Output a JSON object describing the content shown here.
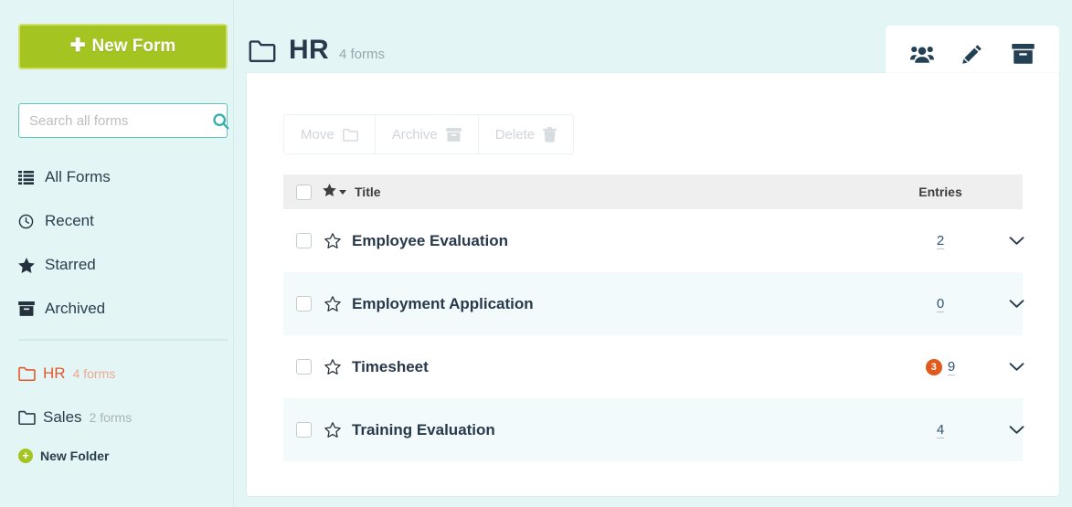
{
  "sidebar": {
    "new_form_button": "New Form",
    "plus_glyph": "✚",
    "search": {
      "placeholder": "Search all forms",
      "value": "",
      "icon": "search-icon"
    },
    "nav_items": [
      {
        "label": "All Forms",
        "icon": "list-icon"
      },
      {
        "label": "Recent",
        "icon": "clock-icon"
      },
      {
        "label": "Starred",
        "icon": "star-filled-icon"
      },
      {
        "label": "Archived",
        "icon": "archive-box-icon"
      }
    ],
    "folders": [
      {
        "name": "HR",
        "count": "4 forms",
        "active": true,
        "icon": "folder-icon"
      },
      {
        "name": "Sales",
        "count": "2 forms",
        "active": false,
        "icon": "folder-icon"
      }
    ],
    "new_folder": {
      "label": "New Folder",
      "icon": "circle-plus-icon",
      "glyph": "+"
    }
  },
  "header": {
    "folder_icon": "folder-icon",
    "title": "HR",
    "subtitle": "4 forms",
    "actions": [
      {
        "name": "members-icon",
        "title": "Members"
      },
      {
        "name": "edit-pencil-icon",
        "title": "Edit"
      },
      {
        "name": "archive-box-icon",
        "title": "Archive"
      }
    ]
  },
  "toolbar": {
    "move_label": "Move",
    "archive_label": "Archive",
    "delete_label": "Delete"
  },
  "table": {
    "select_all": false,
    "sort_icon": "star-filled-icon",
    "columns": {
      "title": "Title",
      "entries": "Entries"
    },
    "rows": [
      {
        "title": "Employee Evaluation",
        "entries": "2",
        "badge": "",
        "starred": false
      },
      {
        "title": "Employment Application",
        "entries": "0",
        "badge": "",
        "starred": false
      },
      {
        "title": "Timesheet",
        "entries": "9",
        "badge": "3",
        "starred": false
      },
      {
        "title": "Training Evaluation",
        "entries": "4",
        "badge": "",
        "starred": false
      }
    ]
  },
  "colors": {
    "page_background": "#e3f5f4",
    "accent_green": "#a4c422",
    "accent_teal": "#31b0a8",
    "active_folder": "#e2582c",
    "badge_orange": "#df5a1b",
    "text_dark": "#27394a"
  }
}
